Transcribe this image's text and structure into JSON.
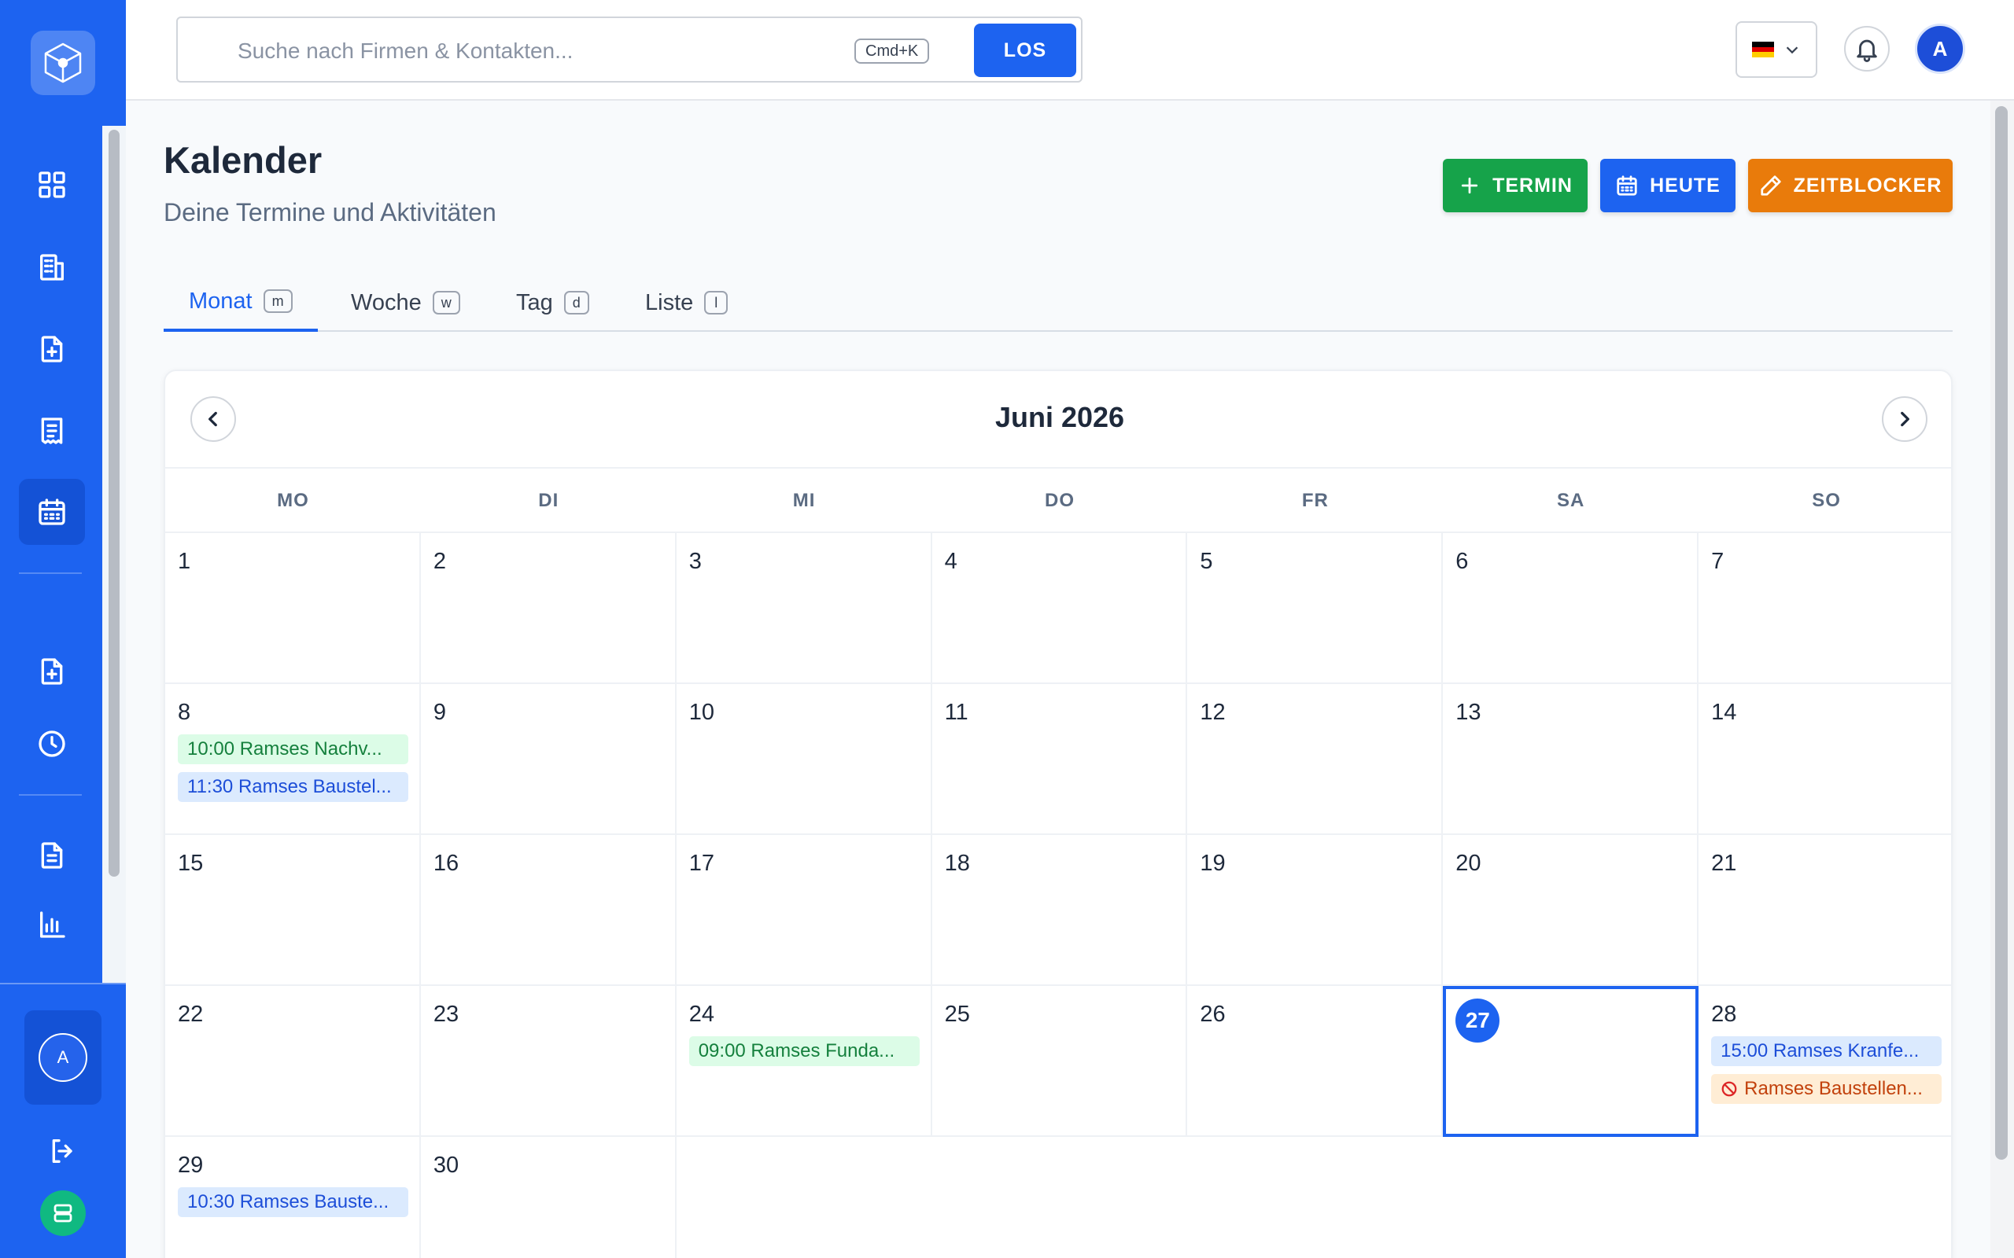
{
  "header": {
    "search_placeholder": "Suche nach Firmen & Kontakten...",
    "search_shortcut": "Cmd+K",
    "search_button": "LOS",
    "language_flag": "de",
    "user_initial": "A"
  },
  "sidebar": {
    "items": [
      {
        "name": "dashboard",
        "icon": "grid-icon",
        "active": false
      },
      {
        "name": "companies",
        "icon": "building-icon",
        "active": false
      },
      {
        "name": "new-document",
        "icon": "file-plus-icon",
        "active": false
      },
      {
        "name": "invoices",
        "icon": "receipt-icon",
        "active": false
      },
      {
        "name": "calendar",
        "icon": "calendar-icon",
        "active": true
      },
      {
        "name": "create-file",
        "icon": "file-plus-icon",
        "active": false
      },
      {
        "name": "time-tracking",
        "icon": "clock-icon",
        "active": false
      },
      {
        "name": "documents",
        "icon": "document-icon",
        "active": false
      },
      {
        "name": "reports",
        "icon": "bar-chart-icon",
        "active": false
      }
    ],
    "user_initial": "A"
  },
  "page": {
    "title": "Kalender",
    "subtitle": "Deine Termine und Aktivitäten",
    "actions": {
      "termin": "TERMIN",
      "heute": "HEUTE",
      "zeitblocker": "ZEITBLOCKER"
    }
  },
  "tabs": [
    {
      "label": "Monat",
      "key": "m",
      "active": true
    },
    {
      "label": "Woche",
      "key": "w",
      "active": false
    },
    {
      "label": "Tag",
      "key": "d",
      "active": false
    },
    {
      "label": "Liste",
      "key": "l",
      "active": false
    }
  ],
  "calendar": {
    "month_title": "Juni 2026",
    "weekdays": [
      "MO",
      "DI",
      "MI",
      "DO",
      "FR",
      "SA",
      "SO"
    ],
    "today": 27,
    "days": [
      {
        "day": "1",
        "events": []
      },
      {
        "day": "2",
        "events": []
      },
      {
        "day": "3",
        "events": []
      },
      {
        "day": "4",
        "events": []
      },
      {
        "day": "5",
        "events": []
      },
      {
        "day": "6",
        "events": []
      },
      {
        "day": "7",
        "events": []
      },
      {
        "day": "8",
        "events": [
          {
            "text": "10:00 Ramses Nachv...",
            "color": "green"
          },
          {
            "text": "11:30 Ramses Baustel...",
            "color": "blue"
          }
        ]
      },
      {
        "day": "9",
        "events": []
      },
      {
        "day": "10",
        "events": []
      },
      {
        "day": "11",
        "events": []
      },
      {
        "day": "12",
        "events": []
      },
      {
        "day": "13",
        "events": []
      },
      {
        "day": "14",
        "events": []
      },
      {
        "day": "15",
        "events": []
      },
      {
        "day": "16",
        "events": []
      },
      {
        "day": "17",
        "events": []
      },
      {
        "day": "18",
        "events": []
      },
      {
        "day": "19",
        "events": []
      },
      {
        "day": "20",
        "events": []
      },
      {
        "day": "21",
        "events": []
      },
      {
        "day": "22",
        "events": []
      },
      {
        "day": "23",
        "events": []
      },
      {
        "day": "24",
        "events": [
          {
            "text": "09:00 Ramses Funda...",
            "color": "green"
          }
        ]
      },
      {
        "day": "25",
        "events": []
      },
      {
        "day": "26",
        "events": []
      },
      {
        "day": "27",
        "events": []
      },
      {
        "day": "28",
        "events": [
          {
            "text": "15:00 Ramses Kranfe...",
            "color": "blue"
          },
          {
            "text": "Ramses Baustellen...",
            "color": "orange",
            "icon": "blocked-icon"
          }
        ]
      },
      {
        "day": "29",
        "events": [
          {
            "text": "10:30 Ramses Bauste...",
            "color": "blue"
          }
        ]
      },
      {
        "day": "30",
        "events": []
      }
    ]
  },
  "colors": {
    "primary": "#1d63f0",
    "success": "#16a34a",
    "warning": "#e97b0b"
  }
}
